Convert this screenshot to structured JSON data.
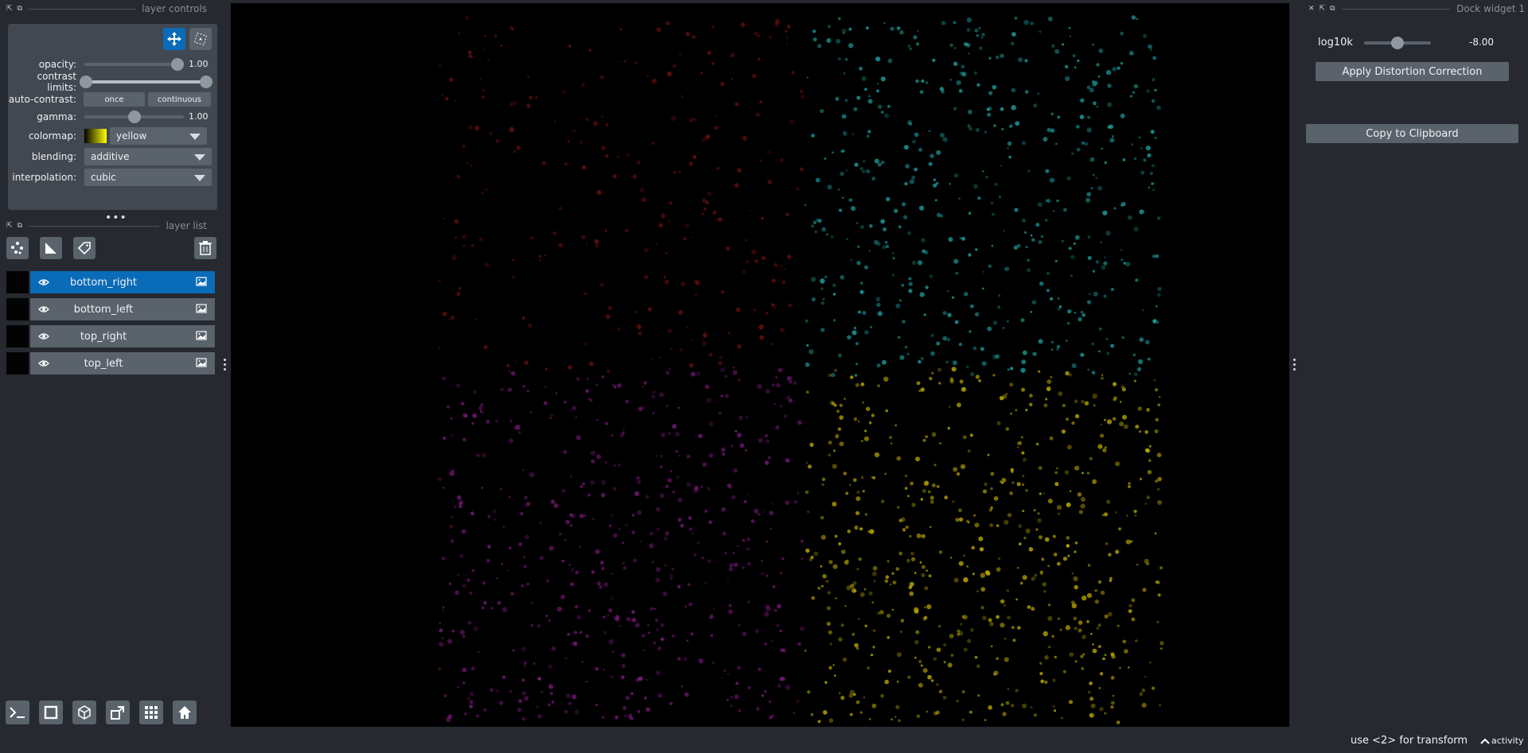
{
  "layer_controls": {
    "title": "layer controls",
    "opacity": {
      "label": "opacity:",
      "value": "1.00",
      "level": 1.0
    },
    "contrast_limits": {
      "label": "contrast limits:",
      "low": 0.0,
      "high": 1.0
    },
    "auto_contrast": {
      "label": "auto-contrast:",
      "once": "once",
      "continuous": "continuous"
    },
    "gamma": {
      "label": "gamma:",
      "value": "1.00",
      "level": 0.5
    },
    "colormap": {
      "label": "colormap:",
      "value": "yellow"
    },
    "blending": {
      "label": "blending:",
      "value": "additive"
    },
    "interpolation": {
      "label": "interpolation:",
      "value": "cubic"
    }
  },
  "layer_list": {
    "title": "layer list",
    "layers": [
      {
        "name": "bottom_right",
        "selected": true,
        "color": "#c8b400"
      },
      {
        "name": "bottom_left",
        "selected": false,
        "color": "#a020a0"
      },
      {
        "name": "top_right",
        "selected": false,
        "color": "#20b0b0"
      },
      {
        "name": "top_left",
        "selected": false,
        "color": "#b01818"
      }
    ]
  },
  "dock_widget": {
    "title": "Dock widget 1",
    "log10k": {
      "label": "log10k",
      "value": "-8.00",
      "level": 0.5
    },
    "apply_button": "Apply Distortion Correction",
    "copy_button": "Copy to Clipboard"
  },
  "status": {
    "message": "use <2> for transform",
    "activity": "activity"
  },
  "colors": {
    "accent": "#0a6bb8",
    "panel": "#262930",
    "widget": "#5a626c"
  }
}
